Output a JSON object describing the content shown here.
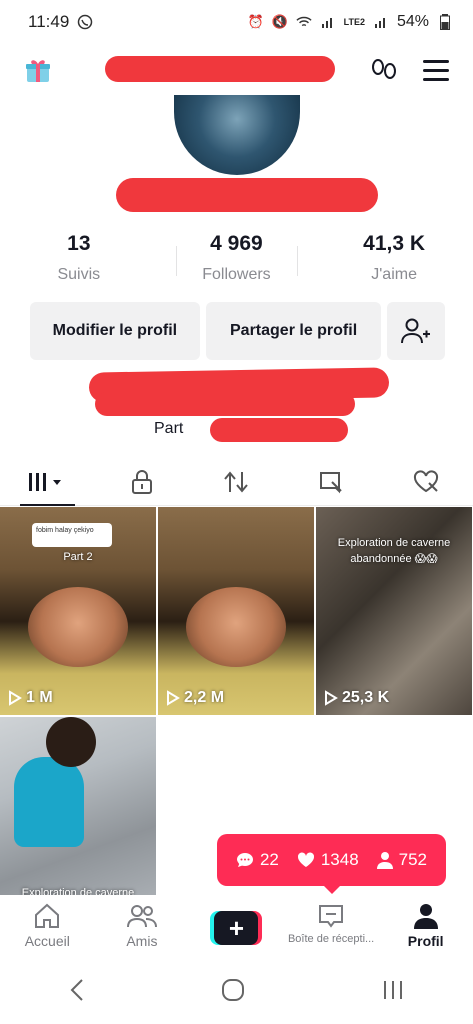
{
  "status_bar": {
    "time": "11:49",
    "battery": "54%",
    "network": "LTE2"
  },
  "stats": [
    {
      "value": "13",
      "label": "Suivis"
    },
    {
      "value": "4 969",
      "label": "Followers"
    },
    {
      "value": "41,3 K",
      "label": "J'aime"
    }
  ],
  "buttons": {
    "edit": "Modifier le profil",
    "share": "Partager le profil"
  },
  "bio_fragment": "Part",
  "videos": [
    {
      "views": "1 M",
      "caption": "Part 2",
      "reply": "fobim halay çekiyo"
    },
    {
      "views": "2,2 M"
    },
    {
      "views": "25,3 K",
      "caption": "Exploration de caverne abandonnée 😱😱"
    },
    {
      "caption": "Exploration de caverne"
    }
  ],
  "notification_pill": {
    "comments": "22",
    "likes": "1348",
    "followers": "752"
  },
  "bottom_nav": {
    "home": "Accueil",
    "friends": "Amis",
    "inbox": "Boîte de récepti...",
    "profile": "Profil"
  },
  "colors": {
    "accent": "#fe2c55",
    "cyan": "#25f4ee",
    "redaction": "#f0383d"
  }
}
